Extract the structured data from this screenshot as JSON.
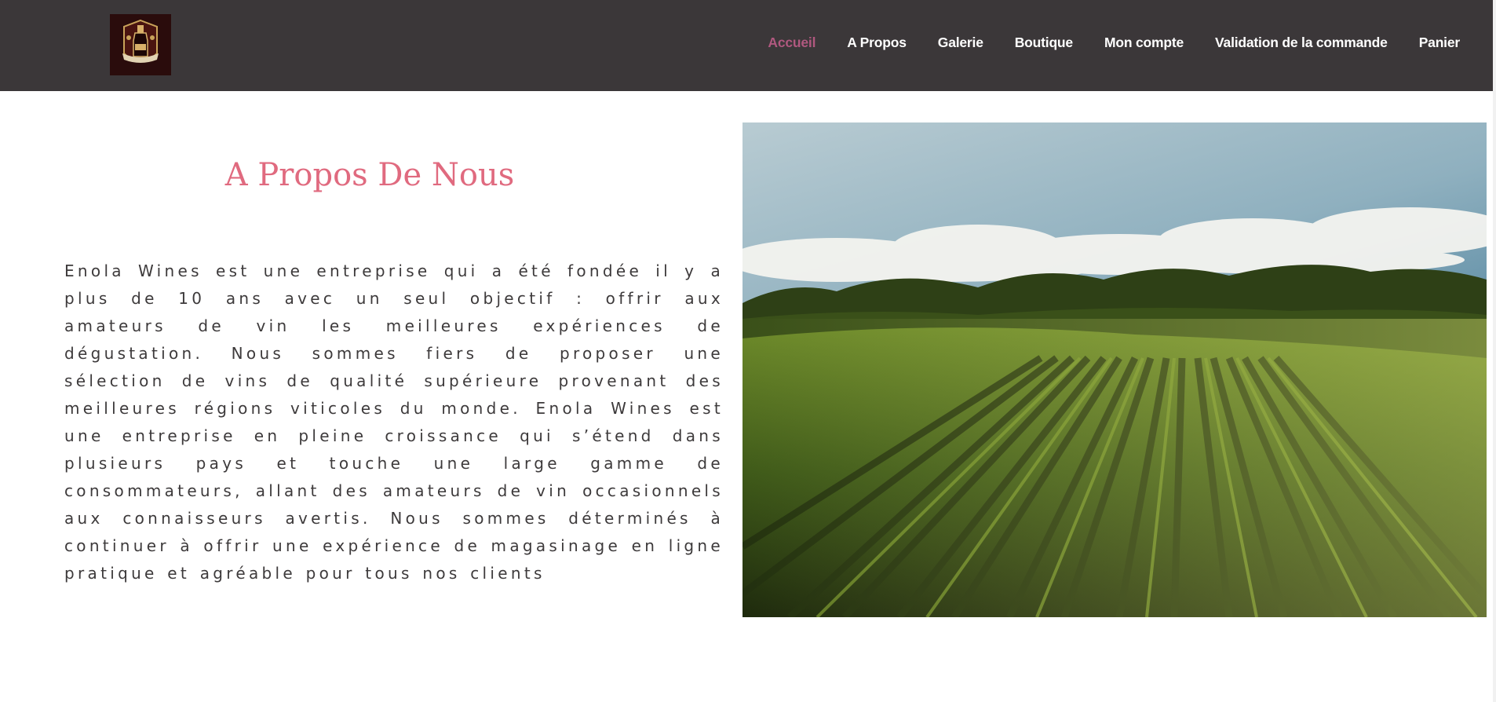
{
  "header": {
    "logo_icon": "wine-bottle-logo-icon",
    "nav": [
      {
        "label": "Accueil",
        "active": true
      },
      {
        "label": "A Propos",
        "active": false
      },
      {
        "label": "Galerie",
        "active": false
      },
      {
        "label": "Boutique",
        "active": false
      },
      {
        "label": "Mon compte",
        "active": false
      },
      {
        "label": "Validation de la commande",
        "active": false
      },
      {
        "label": "Panier",
        "active": false
      }
    ]
  },
  "about": {
    "title": "A Propos De Nous",
    "body": "Enola Wines est une entreprise qui a été fondée il y a plus de 10 ans avec un seul objectif : offrir aux amateurs de vin les meilleures expériences de dégustation. Nous sommes fiers de proposer une sélection de vins de qualité supérieure provenant des meilleures régions viticoles du monde. Enola Wines est une entreprise en pleine croissance qui s’étend dans plusieurs pays et touche une large gamme de consommateurs, allant des amateurs de vin occasionnels aux connaisseurs avertis. Nous sommes déterminés à continuer à offrir une expérience de magasinage en ligne pratique et agréable pour tous nos clients"
  },
  "colors": {
    "header_bg": "#3b3739",
    "nav_active": "#b0587f",
    "nav_text": "#ffffff",
    "title": "#e06a7f",
    "body_text": "#3d3a3b"
  }
}
